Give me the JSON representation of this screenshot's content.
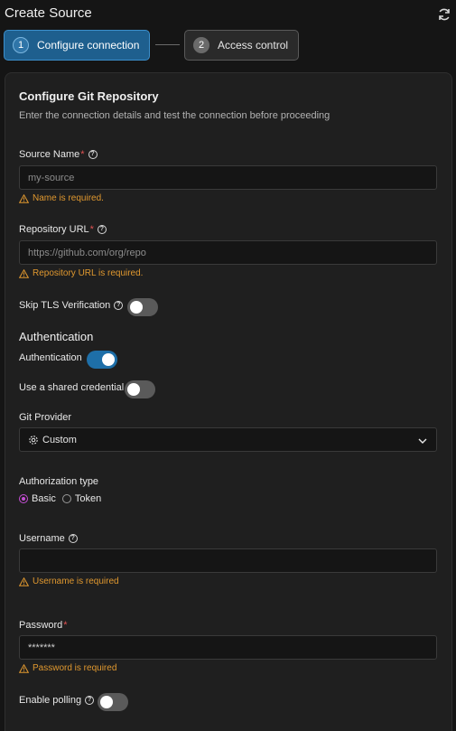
{
  "header": {
    "title": "Create Source"
  },
  "steps": [
    {
      "num": "1",
      "label": "Configure connection"
    },
    {
      "num": "2",
      "label": "Access control"
    }
  ],
  "form": {
    "heading": "Configure Git Repository",
    "subheading": "Enter the connection details and test the connection before proceeding",
    "source_name": {
      "label": "Source Name",
      "required_mark": "*",
      "placeholder": "my-source",
      "error": "Name is required."
    },
    "repo_url": {
      "label": "Repository URL",
      "required_mark": "*",
      "placeholder": "https://github.com/org/repo",
      "error": "Repository URL is required."
    },
    "skip_tls": {
      "label": "Skip TLS Verification",
      "on": false
    },
    "auth_section": "Authentication",
    "auth_toggle": {
      "label": "Authentication",
      "on": true
    },
    "shared_cred": {
      "label": "Use a shared credential",
      "on": false
    },
    "git_provider": {
      "label": "Git Provider",
      "value": "Custom"
    },
    "auth_type": {
      "label": "Authorization type",
      "options": [
        {
          "label": "Basic",
          "selected": true
        },
        {
          "label": "Token",
          "selected": false
        }
      ]
    },
    "username": {
      "label": "Username",
      "value": "",
      "error": "Username is required"
    },
    "password": {
      "label": "Password",
      "required_mark": "*",
      "value": "*******",
      "error": "Password is required"
    },
    "polling": {
      "label": "Enable polling",
      "on": false
    }
  },
  "colors": {
    "accent": "#1e6fa8",
    "warning": "#e0982f",
    "required": "#e05252",
    "radio": "#c64fd6"
  }
}
